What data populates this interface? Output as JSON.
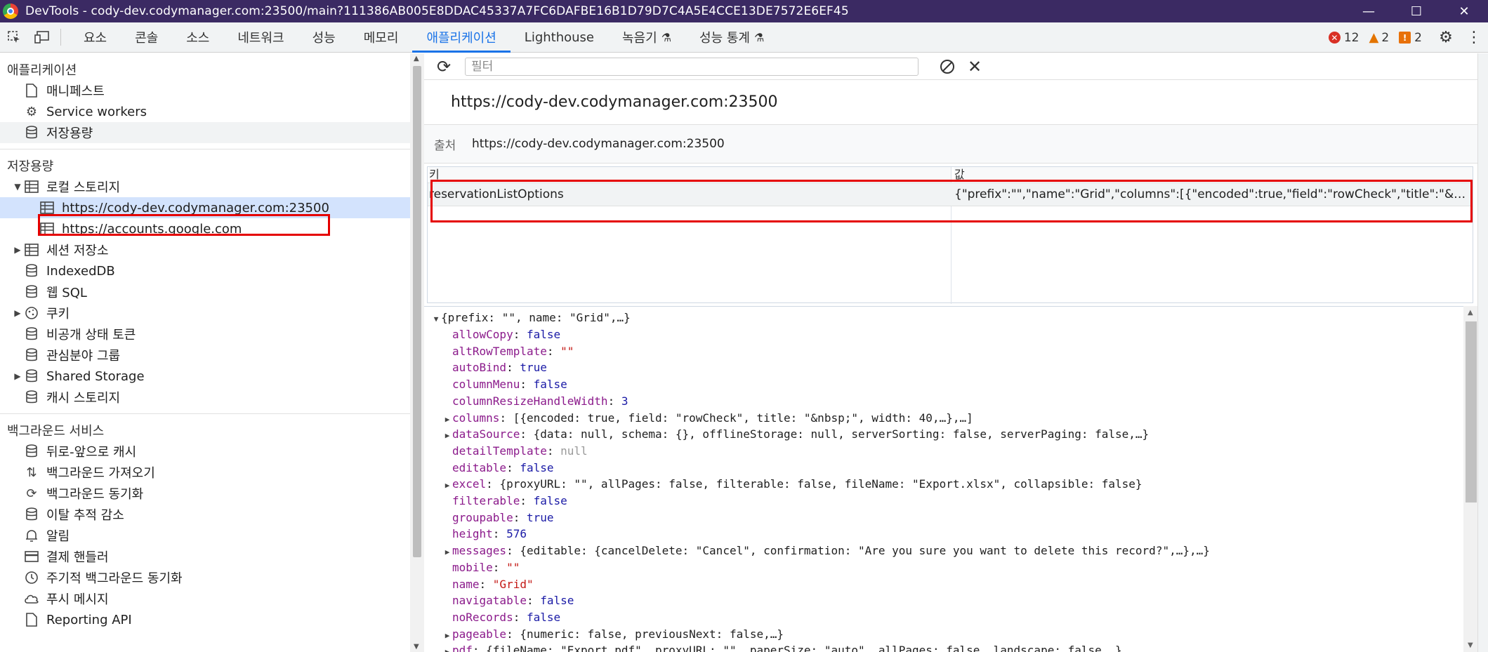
{
  "window": {
    "title": "DevTools - cody-dev.codymanager.com:23500/main?111386AB005E8DDAC45337A7FC6DAFBE16B1D79D7C4A5E4CCE13DE7572E6EF45",
    "minimize": "—",
    "maximize": "☐",
    "close": "✕"
  },
  "tabs": [
    {
      "label": "요소"
    },
    {
      "label": "콘솔"
    },
    {
      "label": "소스"
    },
    {
      "label": "네트워크"
    },
    {
      "label": "성능"
    },
    {
      "label": "메모리"
    },
    {
      "label": "애플리케이션"
    },
    {
      "label": "Lighthouse"
    },
    {
      "label": "녹음기"
    },
    {
      "label": "성능 통계"
    }
  ],
  "status": {
    "errors": "12",
    "warnings": "2",
    "issues": "2"
  },
  "sidebar": {
    "app_section": "애플리케이션",
    "app_items": [
      {
        "label": "매니페스트",
        "icon": "file-icon"
      },
      {
        "label": "Service workers",
        "icon": "gears-icon"
      },
      {
        "label": "저장용량",
        "icon": "database-icon"
      }
    ],
    "storage_section": "저장용량",
    "storage_items": [
      {
        "label": "로컬 스토리지"
      },
      {
        "label": "https://cody-dev.codymanager.com:23500"
      },
      {
        "label": "https://accounts.google.com"
      },
      {
        "label": "세션 저장소"
      },
      {
        "label": "IndexedDB"
      },
      {
        "label": "웹 SQL"
      },
      {
        "label": "쿠키"
      },
      {
        "label": "비공개 상태 토큰"
      },
      {
        "label": "관심분야 그룹"
      },
      {
        "label": "Shared Storage"
      },
      {
        "label": "캐시 스토리지"
      }
    ],
    "bg_section": "백그라운드 서비스",
    "bg_items": [
      {
        "label": "뒤로-앞으로 캐시"
      },
      {
        "label": "백그라운드 가져오기"
      },
      {
        "label": "백그라운드 동기화"
      },
      {
        "label": "이탈 추적 감소"
      },
      {
        "label": "알림"
      },
      {
        "label": "결제 핸들러"
      },
      {
        "label": "주기적 백그라운드 동기화"
      },
      {
        "label": "푸시 메시지"
      },
      {
        "label": "Reporting API"
      }
    ]
  },
  "main": {
    "filter_placeholder": "필터",
    "origin_title": "https://cody-dev.codymanager.com:23500",
    "origin_label": "출처",
    "origin_value": "https://cody-dev.codymanager.com:23500",
    "col_key": "키",
    "col_value": "값",
    "row_key": "reservationListOptions",
    "row_value": "{\"prefix\":\"\",\"name\":\"Grid\",\"columns\":[{\"encoded\":true,\"field\":\"rowCheck\",\"title\":\"&nbsp;\",\"wi..."
  },
  "preview": {
    "root": "{prefix: \"\", name: \"Grid\",…}",
    "lines": [
      {
        "key": "allowCopy",
        "value": "false",
        "kind": "bool",
        "expandable": false
      },
      {
        "key": "altRowTemplate",
        "value": "\"\"",
        "kind": "str",
        "expandable": false
      },
      {
        "key": "autoBind",
        "value": "true",
        "kind": "bool",
        "expandable": false
      },
      {
        "key": "columnMenu",
        "value": "false",
        "kind": "bool",
        "expandable": false
      },
      {
        "key": "columnResizeHandleWidth",
        "value": "3",
        "kind": "num",
        "expandable": false
      },
      {
        "key": "columns",
        "value": "[{encoded: true, field: \"rowCheck\", title: \"&nbsp;\", width: 40,…},…]",
        "kind": "obj",
        "expandable": true
      },
      {
        "key": "dataSource",
        "value": "{data: null, schema: {}, offlineStorage: null, serverSorting: false, serverPaging: false,…}",
        "kind": "obj",
        "expandable": true
      },
      {
        "key": "detailTemplate",
        "value": "null",
        "kind": "null",
        "expandable": false
      },
      {
        "key": "editable",
        "value": "false",
        "kind": "bool",
        "expandable": false
      },
      {
        "key": "excel",
        "value": "{proxyURL: \"\", allPages: false, filterable: false, fileName: \"Export.xlsx\", collapsible: false}",
        "kind": "obj",
        "expandable": true
      },
      {
        "key": "filterable",
        "value": "false",
        "kind": "bool",
        "expandable": false
      },
      {
        "key": "groupable",
        "value": "true",
        "kind": "bool",
        "expandable": false
      },
      {
        "key": "height",
        "value": "576",
        "kind": "num",
        "expandable": false
      },
      {
        "key": "messages",
        "value": "{editable: {cancelDelete: \"Cancel\", confirmation: \"Are you sure you want to delete this record?\",…},…}",
        "kind": "obj",
        "expandable": true
      },
      {
        "key": "mobile",
        "value": "\"\"",
        "kind": "str",
        "expandable": false
      },
      {
        "key": "name",
        "value": "\"Grid\"",
        "kind": "str",
        "expandable": false
      },
      {
        "key": "navigatable",
        "value": "false",
        "kind": "bool",
        "expandable": false
      },
      {
        "key": "noRecords",
        "value": "false",
        "kind": "bool",
        "expandable": false
      },
      {
        "key": "pageable",
        "value": "{numeric: false, previousNext: false,…}",
        "kind": "obj",
        "expandable": true
      },
      {
        "key": "pdf",
        "value": "{fileName: \"Export.pdf\", proxyURL: \"\", paperSize: \"auto\", allPages: false, landscape: false,…}",
        "kind": "obj",
        "expandable": true
      }
    ]
  },
  "colors": {
    "titlebar": "#3b2a63",
    "accent": "#1a73e8",
    "highlight": "#e50000"
  }
}
